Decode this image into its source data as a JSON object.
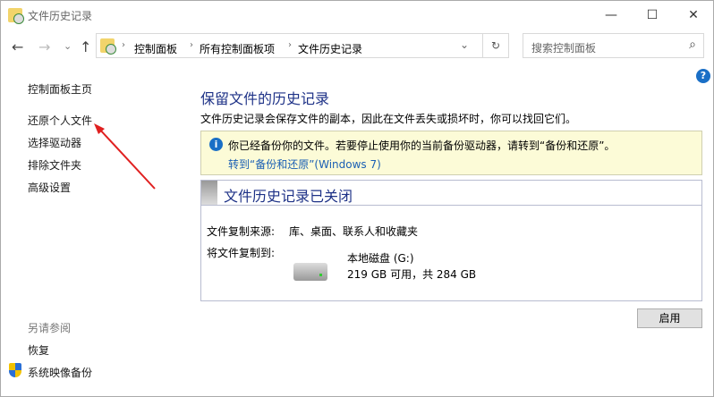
{
  "window": {
    "title": "文件历史记录",
    "minimize": "—",
    "maximize": "☐",
    "close": "✕"
  },
  "nav": {
    "back": "←",
    "forward": "→",
    "recent": "⌄",
    "up": "↑",
    "refresh": "↻",
    "dropdown": "⌄"
  },
  "breadcrumb": [
    "控制面板",
    "所有控制面板项",
    "文件历史记录"
  ],
  "search": {
    "placeholder": "搜索控制面板",
    "icon": "⌕"
  },
  "sidebar": {
    "items": [
      "控制面板主页",
      "还原个人文件",
      "选择驱动器",
      "排除文件夹",
      "高级设置"
    ],
    "see_also_label": "另请参阅",
    "see_also": [
      "恢复",
      "系统映像备份"
    ]
  },
  "main": {
    "title": "保留文件的历史记录",
    "description": "文件历史记录会保存文件的副本，因此在文件丢失或损坏时，你可以找回它们。",
    "info": {
      "text": "你已经备份你的文件。若要停止使用你的当前备份驱动器，请转到“备份和还原”。",
      "link": "转到“备份和还原”(Windows 7)"
    },
    "status": {
      "title": "文件历史记录已关闭",
      "source_label": "文件复制来源:",
      "source_value": "库、桌面、联系人和收藏夹",
      "dest_label": "将文件复制到:",
      "drive_name": "本地磁盘 (G:)",
      "drive_space": "219 GB 可用，共 284 GB"
    },
    "enable_button": "启用"
  },
  "help": "?"
}
